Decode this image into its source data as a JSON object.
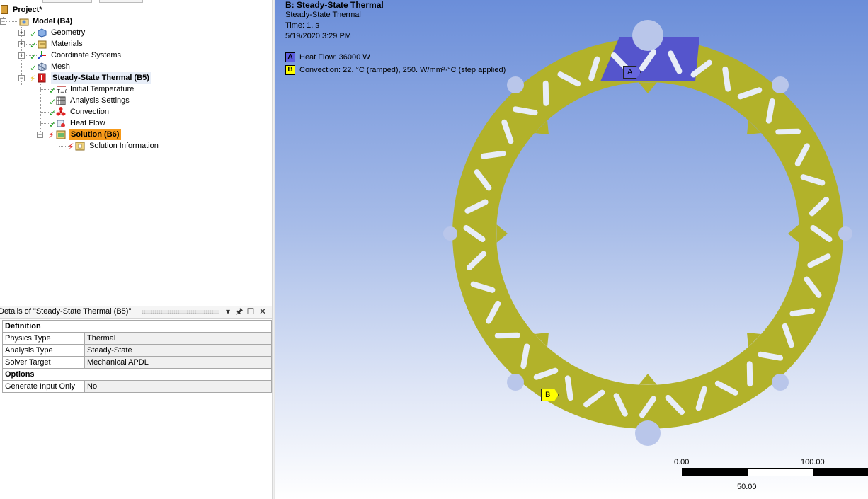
{
  "tree": {
    "root": "Project*",
    "model": "Model (B4)",
    "geometry": "Geometry",
    "materials": "Materials",
    "coordinate_systems": "Coordinate Systems",
    "mesh": "Mesh",
    "analysis": "Steady-State Thermal (B5)",
    "initial_temperature": "Initial Temperature",
    "analysis_settings": "Analysis Settings",
    "convection": "Convection",
    "heat_flow": "Heat Flow",
    "solution": "Solution (B6)",
    "solution_information": "Solution Information",
    "icon_text_t0": "T=0"
  },
  "details": {
    "title": "Details of \"Steady-State Thermal (B5)\"",
    "groups": [
      {
        "name": "Definition",
        "rows": [
          {
            "key": "Physics Type",
            "value": "Thermal"
          },
          {
            "key": "Analysis Type",
            "value": "Steady-State"
          },
          {
            "key": "Solver Target",
            "value": "Mechanical APDL"
          }
        ]
      },
      {
        "name": "Options",
        "rows": [
          {
            "key": "Generate Input Only",
            "value": "No"
          }
        ]
      }
    ]
  },
  "viewport": {
    "header_title": "B: Steady-State Thermal",
    "header_sub": "Steady-State Thermal",
    "time": "Time: 1. s",
    "date": "5/19/2020 3:29 PM",
    "legend": [
      {
        "letter": "A",
        "text": "Heat Flow: 36000 W",
        "color": "#5c5ce0"
      },
      {
        "letter": "B",
        "text": "Convection: 22. °C  (ramped), 250. W/mm²·°C  (step applied)",
        "color": "#ffff00"
      }
    ],
    "tag_a": "A",
    "tag_b": "B",
    "scale": {
      "left": "0.00",
      "right": "100.00",
      "middle": "50.00"
    }
  },
  "colors": {
    "part": "#b2b22a",
    "heat_flow_face": "#5555cc",
    "selected": "#f79a1a",
    "bg_top": "#6b8ed9"
  }
}
